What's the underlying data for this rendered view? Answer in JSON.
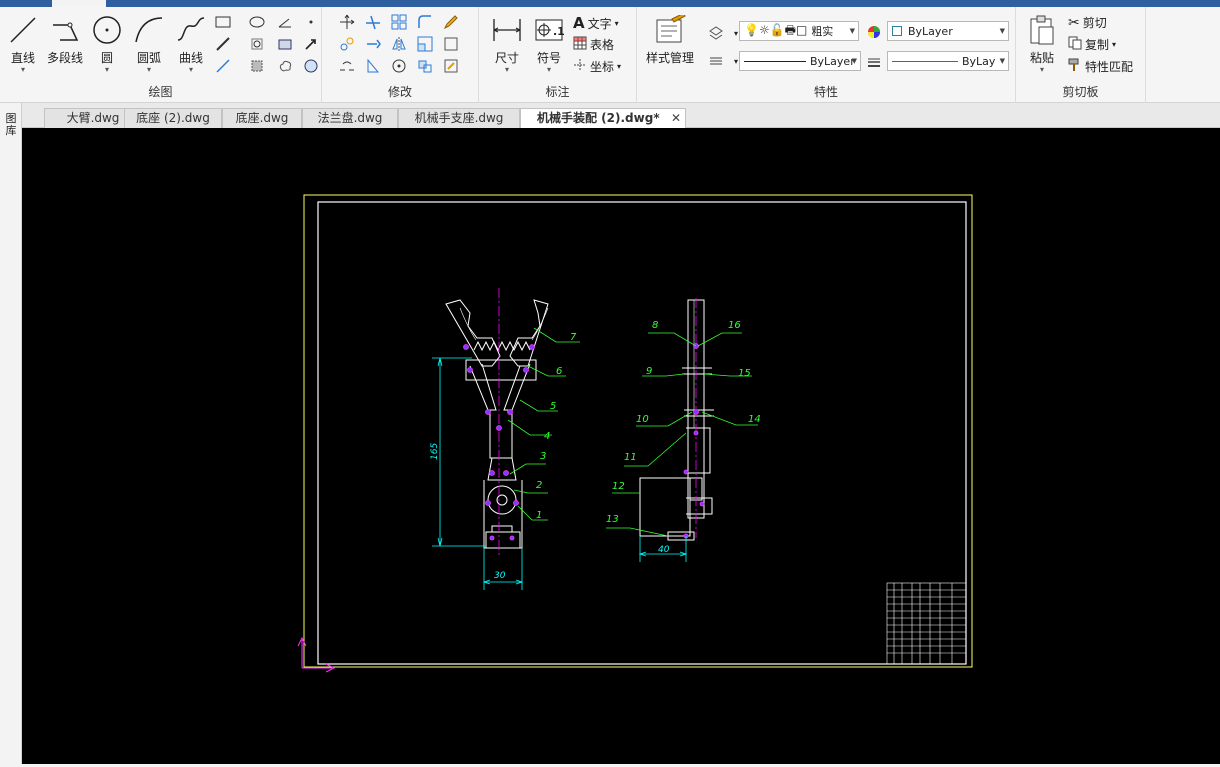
{
  "ribbon": {
    "draw": {
      "title": "绘图",
      "line": "直线",
      "polyline": "多段线",
      "circle": "圆",
      "arc": "圆弧",
      "spline": "曲线"
    },
    "modify": {
      "title": "修改"
    },
    "annotate": {
      "title": "标注",
      "dimension": "尺寸",
      "symbol": "符号",
      "text": "文字",
      "table": "表格",
      "coordinate": "坐标"
    },
    "properties": {
      "title": "特性",
      "style_manager": "样式管理",
      "layer_name": "粗实",
      "color_value": "ByLayer",
      "linetype_value": "ByLayer",
      "lineweight_value": "ByLay"
    },
    "clipboard": {
      "title": "剪切板",
      "paste": "粘贴",
      "cut": "剪切",
      "copy": "复制",
      "match": "特性匹配"
    }
  },
  "left_strip": {
    "label": "图库"
  },
  "tabs": [
    {
      "label": "大臂.dwg"
    },
    {
      "label": "底座 (2).dwg"
    },
    {
      "label": "底座.dwg"
    },
    {
      "label": "法兰盘.dwg"
    },
    {
      "label": "机械手支座.dwg"
    },
    {
      "label": "机械手装配 (2).dwg*",
      "active": true
    }
  ],
  "tab_close": "✕",
  "drawing": {
    "part_numbers": [
      "1",
      "2",
      "3",
      "4",
      "5",
      "6",
      "7",
      "8",
      "9",
      "10",
      "11",
      "12",
      "13",
      "14",
      "15",
      "16"
    ],
    "dimensions": {
      "height": "165",
      "width_front": "30",
      "width_side": "40"
    }
  },
  "colors": {
    "canvas": "#000000",
    "border": "#ffff66",
    "outline": "#ffffff",
    "leader": "#33ff33",
    "dimension": "#00ffff",
    "center": "#ff00ff",
    "accent": "#2f5f9e"
  }
}
